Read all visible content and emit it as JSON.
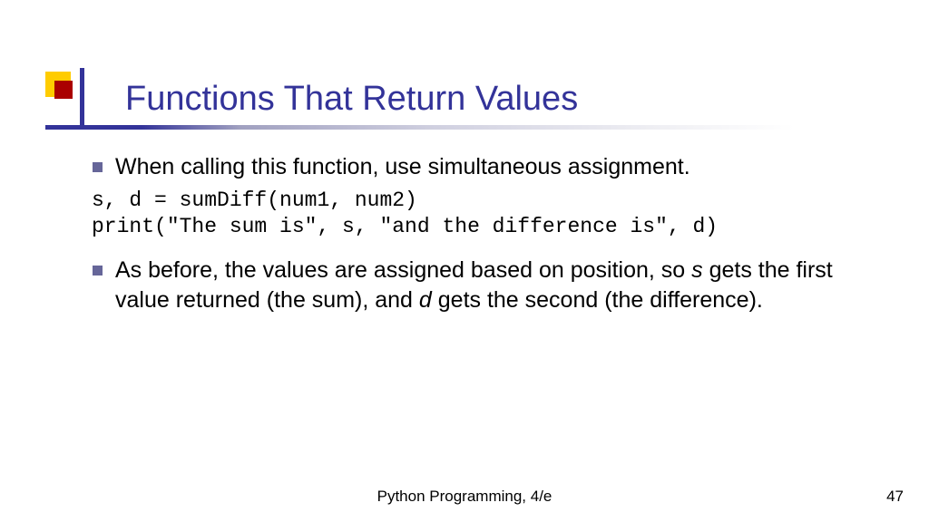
{
  "title": "Functions That Return Values",
  "bullets": {
    "b1": "When calling this function, use simultaneous assignment.",
    "b2_pre": "As before, the values are assigned based on position, so ",
    "b2_s": "s",
    "b2_mid": " gets the first value returned (the sum), and ",
    "b2_d": "d",
    "b2_post": " gets the second (the difference)."
  },
  "code": "s, d = sumDiff(num1, num2)\nprint(\"The sum is\", s, \"and the difference is\", d)",
  "footer": {
    "book": "Python Programming, 4/e",
    "page": "47"
  }
}
